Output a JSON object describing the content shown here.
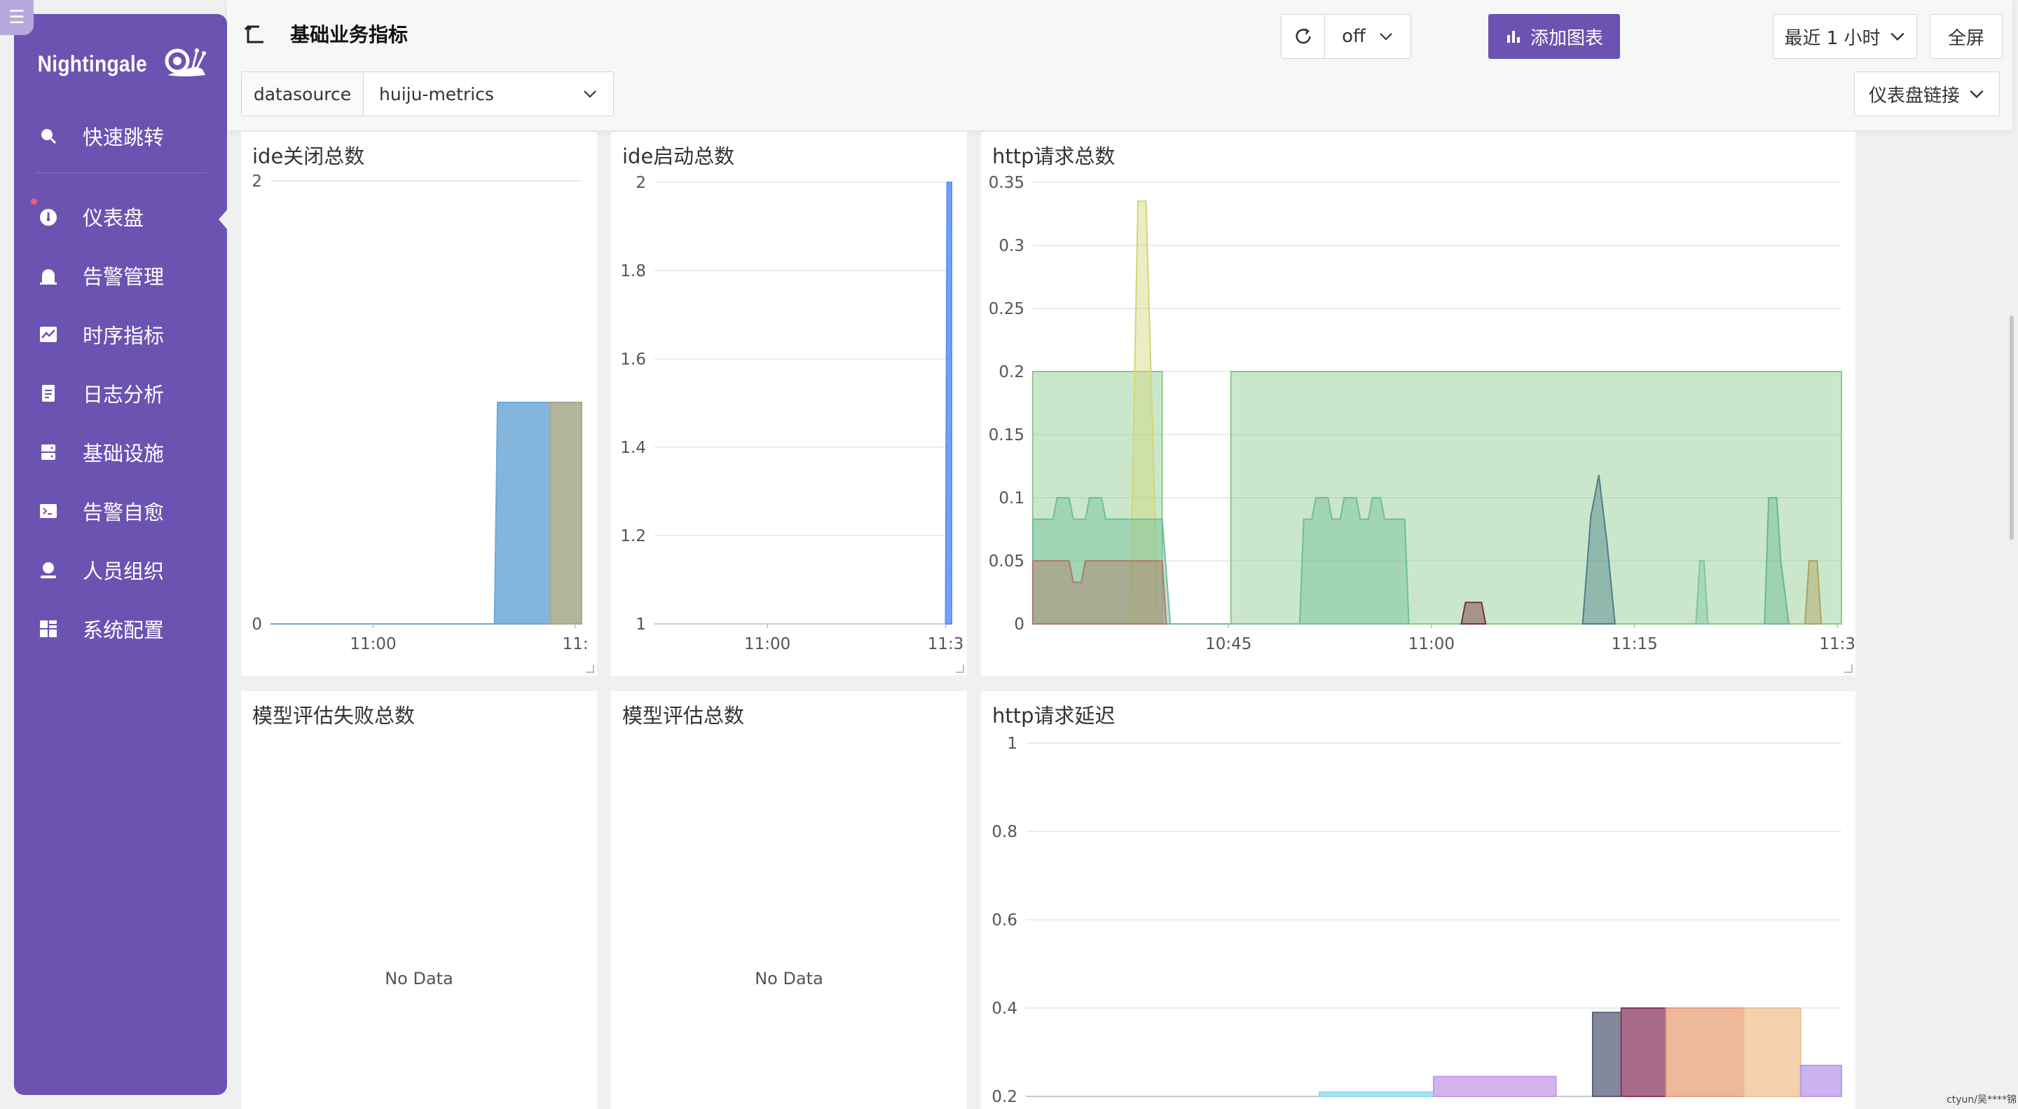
{
  "sidebar": {
    "logo": "Nightingale",
    "items": [
      {
        "label": "快速跳转",
        "icon": "search-icon"
      },
      {
        "label": "仪表盘",
        "icon": "dashboard-icon",
        "active": true
      },
      {
        "label": "告警管理",
        "icon": "alarm-icon"
      },
      {
        "label": "时序指标",
        "icon": "line-chart-icon"
      },
      {
        "label": "日志分析",
        "icon": "log-icon"
      },
      {
        "label": "基础设施",
        "icon": "server-icon"
      },
      {
        "label": "告警自愈",
        "icon": "terminal-icon"
      },
      {
        "label": "人员组织",
        "icon": "user-icon"
      },
      {
        "label": "系统配置",
        "icon": "settings-grid-icon"
      }
    ]
  },
  "header": {
    "title": "基础业务指标",
    "add_chart": "添加图表",
    "refresh_value": "off",
    "time_range": "最近 1 小时",
    "fullscreen": "全屏",
    "dashboard_links": "仪表盘链接"
  },
  "variables": {
    "label": "datasource",
    "value": "huiju-metrics"
  },
  "colors": {
    "accent": "#6c53b1"
  },
  "panels": {
    "ide_close": {
      "title": "ide关闭总数"
    },
    "ide_start": {
      "title": "ide启动总数"
    },
    "http_total": {
      "title": "http请求总数"
    },
    "eval_fail": {
      "title": "模型评估失败总数",
      "empty": "No Data"
    },
    "eval_total": {
      "title": "模型评估总数",
      "empty": "No Data"
    },
    "http_latency": {
      "title": "http请求延迟"
    }
  },
  "chart_data": [
    {
      "type": "area",
      "title": "ide关闭总数",
      "x_ticks": [
        "11:00",
        "11:"
      ],
      "y_ticks": [
        "0",
        "2"
      ],
      "ylim": [
        0,
        2
      ],
      "series": [
        {
          "color": "#6fa8d6",
          "x": [
            0,
            0.72,
            0.73,
            0.9
          ],
          "values": [
            0,
            0,
            1,
            1
          ]
        },
        {
          "color": "#a7a98a",
          "x": [
            0.9,
            1.0
          ],
          "values": [
            1,
            1
          ]
        }
      ]
    },
    {
      "type": "area",
      "title": "ide启动总数",
      "x_ticks": [
        "11:00",
        "11:3"
      ],
      "y_ticks": [
        "1",
        "1.2",
        "1.4",
        "1.6",
        "1.8",
        "2"
      ],
      "ylim": [
        1,
        2
      ],
      "series": [
        {
          "color": "#5b8ff9",
          "x": [
            0.98,
            0.985,
            1.0
          ],
          "values": [
            1,
            2,
            2
          ]
        }
      ]
    },
    {
      "type": "area",
      "title": "http请求总数",
      "x_ticks": [
        "10:45",
        "11:00",
        "11:15",
        "11:3"
      ],
      "y_ticks": [
        "0",
        "0.05",
        "0.1",
        "0.15",
        "0.2",
        "0.25",
        "0.3",
        "0.35"
      ],
      "ylim": [
        0,
        0.35
      ],
      "series": [
        {
          "color": "#8bc98b",
          "points": [
            [
              0,
              0.2
            ],
            [
              0.16,
              0.2
            ],
            [
              0.16,
              0
            ],
            [
              0.245,
              0
            ],
            [
              0.245,
              0.2
            ],
            [
              1,
              0.2
            ]
          ]
        },
        {
          "color": "#d3d67a",
          "points": [
            [
              0.12,
              0
            ],
            [
              0.13,
              0.335
            ],
            [
              0.14,
              0.335
            ],
            [
              0.155,
              0
            ]
          ]
        },
        {
          "color": "#6fbf9a",
          "points": [
            [
              0,
              0.083
            ],
            [
              0.025,
              0.083
            ],
            [
              0.03,
              0.1
            ],
            [
              0.045,
              0.1
            ],
            [
              0.05,
              0.083
            ],
            [
              0.065,
              0.083
            ],
            [
              0.07,
              0.1
            ],
            [
              0.085,
              0.1
            ],
            [
              0.09,
              0.083
            ],
            [
              0.16,
              0.083
            ],
            [
              0.17,
              0
            ],
            [
              0.33,
              0
            ],
            [
              0.335,
              0.083
            ],
            [
              0.345,
              0.083
            ],
            [
              0.35,
              0.1
            ],
            [
              0.365,
              0.1
            ],
            [
              0.37,
              0.083
            ],
            [
              0.38,
              0.083
            ],
            [
              0.385,
              0.1
            ],
            [
              0.4,
              0.1
            ],
            [
              0.405,
              0.083
            ],
            [
              0.415,
              0.083
            ],
            [
              0.42,
              0.1
            ],
            [
              0.43,
              0.1
            ],
            [
              0.435,
              0.083
            ],
            [
              0.46,
              0.083
            ],
            [
              0.465,
              0
            ]
          ]
        },
        {
          "color": "#b07a6a",
          "points": [
            [
              0,
              0.05
            ],
            [
              0.045,
              0.05
            ],
            [
              0.05,
              0.033
            ],
            [
              0.06,
              0.033
            ],
            [
              0.065,
              0.05
            ],
            [
              0.16,
              0.05
            ],
            [
              0.165,
              0
            ]
          ]
        },
        {
          "color": "#4c7f8a",
          "points": [
            [
              0.68,
              0
            ],
            [
              0.69,
              0.085
            ],
            [
              0.7,
              0.118
            ],
            [
              0.71,
              0.065
            ],
            [
              0.72,
              0
            ]
          ]
        },
        {
          "color": "#7fc4a4",
          "points": [
            [
              0.82,
              0
            ],
            [
              0.825,
              0.05
            ],
            [
              0.83,
              0.05
            ],
            [
              0.835,
              0
            ]
          ]
        },
        {
          "color": "#6ab88c",
          "points": [
            [
              0.905,
              0
            ],
            [
              0.91,
              0.1
            ],
            [
              0.92,
              0.1
            ],
            [
              0.925,
              0.05
            ],
            [
              0.935,
              0
            ]
          ]
        },
        {
          "color": "#b0a060",
          "points": [
            [
              0.955,
              0
            ],
            [
              0.96,
              0.05
            ],
            [
              0.97,
              0.05
            ],
            [
              0.975,
              0
            ]
          ]
        },
        {
          "color": "#7a3042",
          "points": [
            [
              0.53,
              0
            ],
            [
              0.535,
              0.017
            ],
            [
              0.555,
              0.017
            ],
            [
              0.56,
              0
            ]
          ]
        }
      ]
    },
    {
      "type": "area",
      "title": "模型评估失败总数",
      "values": []
    },
    {
      "type": "area",
      "title": "模型评估总数",
      "values": []
    },
    {
      "type": "area",
      "title": "http请求延迟",
      "y_ticks": [
        "0.2",
        "0.4",
        "0.6",
        "0.8",
        "1"
      ],
      "ylim": [
        0.2,
        1
      ],
      "series": [
        {
          "color": "#8fd8ef",
          "x": [
            0.36,
            0.5
          ],
          "values": [
            0.21,
            0.21
          ]
        },
        {
          "color": "#c79ae8",
          "x": [
            0.5,
            0.65
          ],
          "values": [
            0.245,
            0.245
          ]
        },
        {
          "color": "#5a5f7a",
          "x": [
            0.695,
            0.73
          ],
          "values": [
            0.39,
            0.39
          ]
        },
        {
          "color": "#8b3a62",
          "x": [
            0.73,
            0.785
          ],
          "values": [
            0.4,
            0.4
          ]
        },
        {
          "color": "#e8a07a",
          "x": [
            0.785,
            0.88
          ],
          "values": [
            0.4,
            0.4
          ]
        },
        {
          "color": "#f0c090",
          "x": [
            0.88,
            0.95
          ],
          "values": [
            0.4,
            0.4
          ]
        },
        {
          "color": "#b89ae8",
          "x": [
            0.95,
            1.0
          ],
          "values": [
            0.27,
            0.27
          ]
        }
      ]
    }
  ],
  "footer": {
    "user": "ctyun/吴****锦"
  }
}
